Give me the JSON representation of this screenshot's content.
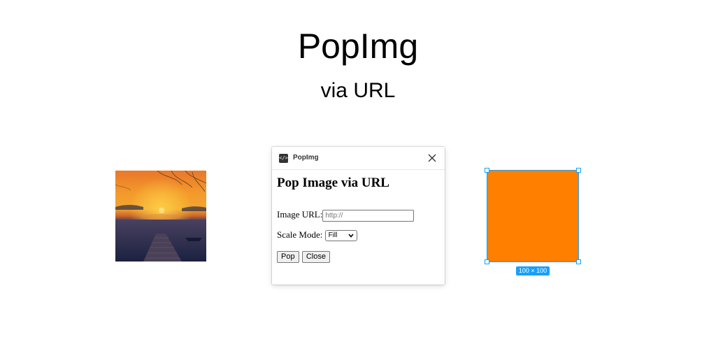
{
  "header": {
    "title": "PopImg",
    "subtitle": "via URL"
  },
  "photo": {
    "icon": "sunset-lake-photo"
  },
  "plugin": {
    "icon_glyph": "</>",
    "name": "PopImg",
    "close_icon": "close-icon",
    "heading": "Pop Image via URL",
    "url_label": "Image URL:",
    "url_placeholder": "http://",
    "url_value": "",
    "scale_label": "Scale Mode:",
    "scale_selected": "Fill",
    "pop_button": "Pop",
    "close_button": "Close"
  },
  "canvas_selection": {
    "fill_color": "#ff7f00",
    "selection_color": "#18a0fb",
    "size_label": "100 × 100"
  }
}
